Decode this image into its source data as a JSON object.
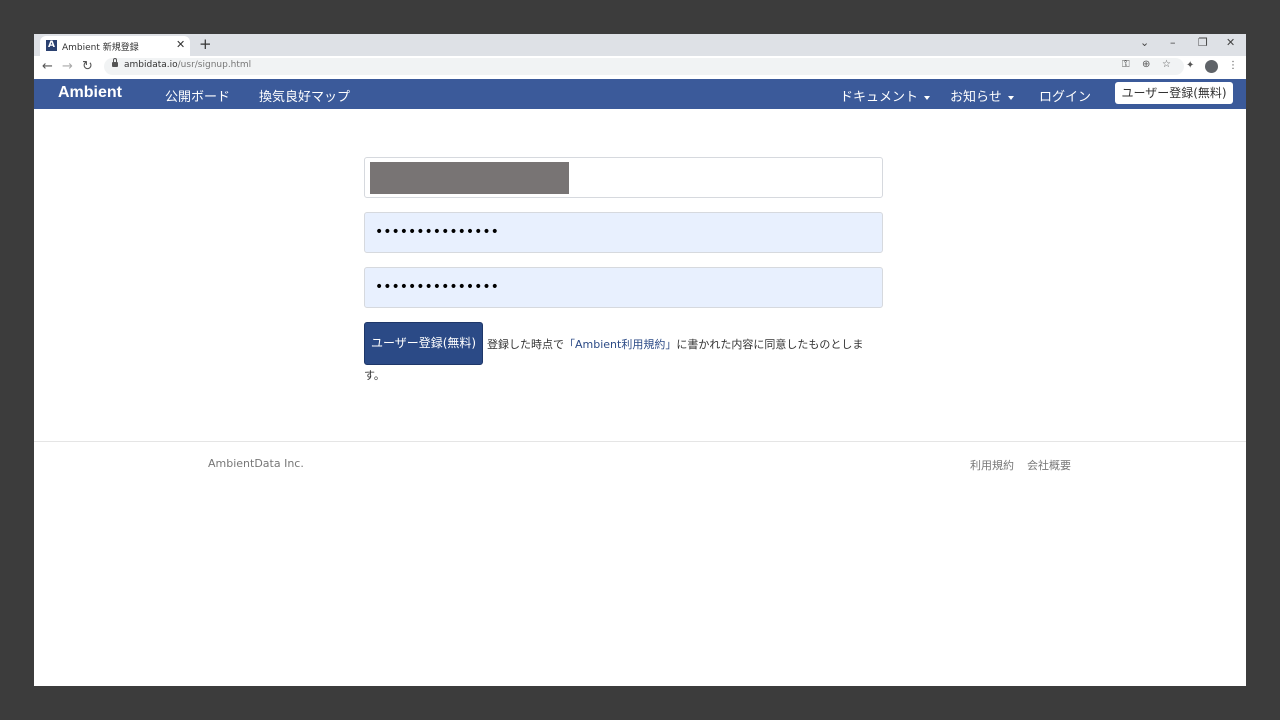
{
  "browser": {
    "tab_title": "Ambient 新規登録",
    "favicon_letter": "A",
    "tab_close": "✕",
    "new_tab": "+",
    "url_host": "ambidata.io",
    "url_path": "/usr/signup.html",
    "window_controls": {
      "chevron": "⌄",
      "minimize": "–",
      "restore": "❐",
      "close": "✕"
    },
    "nav": {
      "back": "←",
      "forward": "→",
      "reload": "↻"
    },
    "toolbar_icons": {
      "key": "⚿",
      "zoom": "⊕",
      "star": "☆",
      "extensions": "✦",
      "menu": "⋮"
    }
  },
  "navbar": {
    "brand": "Ambient",
    "links": {
      "public_board": "公開ボード",
      "ventilation_map": "換気良好マップ",
      "documents": "ドキュメント",
      "news": "お知らせ",
      "login": "ログイン"
    },
    "signup_button": "ユーザー登録(無料)"
  },
  "form": {
    "password_mask": "•••••••••••••••",
    "password_confirm_mask": "•••••••••••••••",
    "submit_label": "ユーザー登録(無料)",
    "agreement_prefix": "登録した時点で",
    "agreement_link": "「Ambient利用規約」",
    "agreement_suffix": "に書かれた内容に同意したものとしま",
    "agreement_tail": "す。"
  },
  "footer": {
    "company": "AmbientData Inc.",
    "terms": "利用規約",
    "about": "会社概要"
  }
}
